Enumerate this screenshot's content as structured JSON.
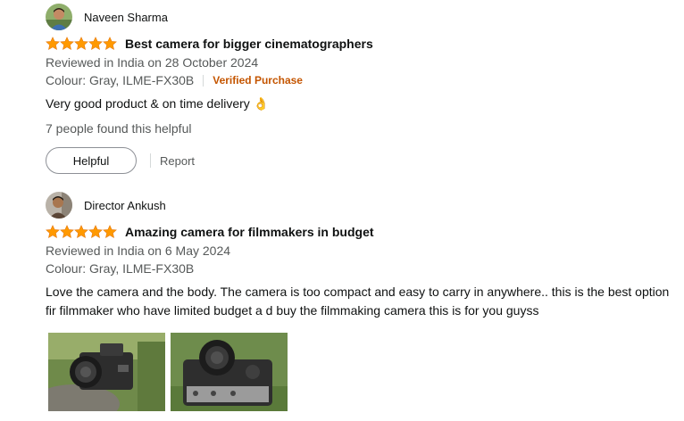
{
  "reviews": [
    {
      "profile_name": "Naveen Sharma",
      "rating": 5,
      "title": "Best camera for bigger cinematographers",
      "date": "Reviewed in India on 28 October 2024",
      "format": "Colour: Gray, ILME-FX30B",
      "verified": "Verified Purchase",
      "body": "Very good product & on time delivery 👌",
      "helpful_count": "7 people found this helpful",
      "helpful_label": "Helpful",
      "report_label": "Report"
    },
    {
      "profile_name": "Director Ankush",
      "rating": 5,
      "title": "Amazing camera for filmmakers in budget",
      "date": "Reviewed in India on 6 May 2024",
      "format": "Colour: Gray, ILME-FX30B",
      "body": "Love the camera and the body. The camera is too compact and easy to carry in anywhere.. this is the best option fir filmmaker who have limited budget a d buy the filmmaking camera this is for you guyss",
      "images": [
        "camera-side-photo",
        "camera-top-photo"
      ]
    }
  ],
  "colors": {
    "star": "#ff9900",
    "verified": "#c45500",
    "muted": "#565959",
    "text": "#0f1111"
  }
}
